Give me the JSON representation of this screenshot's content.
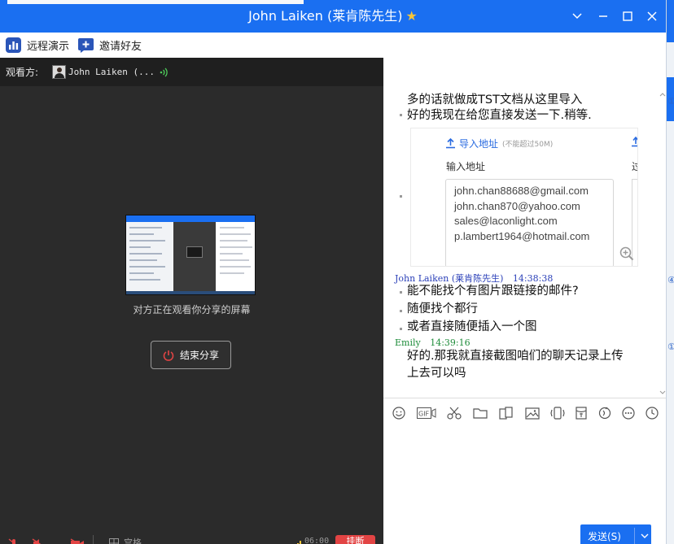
{
  "window": {
    "title": "John Laiken (莱肯陈先生)",
    "title_icon": "star-icon"
  },
  "toolbar": {
    "remote_demo": "远程演示",
    "invite_friends": "邀请好友"
  },
  "viewer_bar": {
    "label": "观看方:",
    "viewer_name": "John Laiken (..."
  },
  "share": {
    "caption": "对方正在观看你分享的屏幕",
    "end_button": "结束分享"
  },
  "bottom_bar": {
    "grid_label": "宫格",
    "time": "06:00",
    "hangup_label": "挂断"
  },
  "chat": {
    "messages_top": [
      "多的话就做成TST文档从这里导入",
      "好的我现在给您直接发送一下.稍等."
    ],
    "image": {
      "upload_label": "导入地址",
      "upload_hint": "(不能超过50M)",
      "field_label": "输入地址",
      "field_label_fragment": "过",
      "addresses": [
        "john.chan88688@gmail.com",
        "john.chan870@yahoo.com",
        "sales@laconlight.com",
        "p.lambert1964@hotmail.com"
      ]
    },
    "group1": {
      "sender": "John Laiken (莱肯陈先生)",
      "time": "14:38:38",
      "lines": [
        "能不能找个有图片跟链接的邮件?",
        "随便找个都行",
        "或者直接随便插入一个图"
      ]
    },
    "group2": {
      "sender": "Emily",
      "time": "14:39:16",
      "lines": [
        "好的.那我就直接截图咱们的聊天记录上传",
        "上去可以吗"
      ]
    }
  },
  "input": {
    "send_label": "发送(S)"
  },
  "colors": {
    "brand_blue": "#1a6ff1",
    "dark_panel": "#2b2b2b",
    "sender_blue": "#2a3fb8",
    "sender_green": "#1e8c3a",
    "hangup_red": "#e24444"
  }
}
